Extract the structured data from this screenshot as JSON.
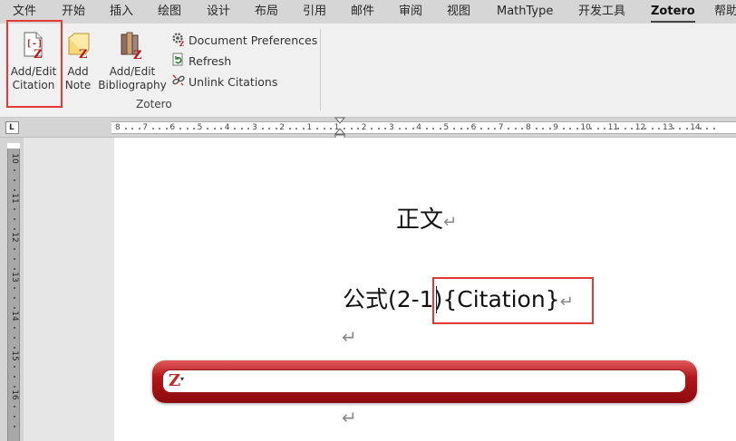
{
  "tabs": [
    {
      "label": "文件",
      "active": false
    },
    {
      "label": "开始",
      "active": false
    },
    {
      "label": "插入",
      "active": false
    },
    {
      "label": "绘图",
      "active": false
    },
    {
      "label": "设计",
      "active": false
    },
    {
      "label": "布局",
      "active": false
    },
    {
      "label": "引用",
      "active": false
    },
    {
      "label": "邮件",
      "active": false
    },
    {
      "label": "审阅",
      "active": false
    },
    {
      "label": "视图",
      "active": false
    },
    {
      "label": "MathType",
      "active": false
    },
    {
      "label": "开发工具",
      "active": false
    },
    {
      "label": "Zotero",
      "active": true
    },
    {
      "label": "帮助",
      "active": false
    }
  ],
  "ribbon": {
    "add_edit_citation": {
      "line1": "Add/Edit",
      "line2": "Citation",
      "icon": "zotero-citation-icon"
    },
    "add_note": {
      "line1": "Add",
      "line2": "Note",
      "icon": "zotero-note-icon"
    },
    "add_edit_bibliography": {
      "line1": "Add/Edit",
      "line2": "Bibliography",
      "icon": "zotero-bibliography-icon"
    },
    "document_preferences": {
      "label": "Document Preferences",
      "icon": "gear-icon"
    },
    "refresh": {
      "label": "Refresh",
      "icon": "refresh-icon"
    },
    "unlink_citations": {
      "label": "Unlink Citations",
      "icon": "unlink-icon"
    },
    "group_label": "Zotero"
  },
  "ruler": {
    "corner_glyph": "L",
    "horizontal_labels": [
      "8",
      "7",
      "6",
      "5",
      "4",
      "3",
      "2",
      "1",
      "1",
      "2",
      "3",
      "4",
      "5",
      "6",
      "7",
      "8",
      "9",
      "10",
      "11",
      "12",
      "13",
      "14"
    ],
    "vertical_labels": [
      "10",
      "11",
      "12",
      "13",
      "14",
      "15",
      "16"
    ]
  },
  "document": {
    "heading": "正文",
    "formula_prefix": "公式(2-1)",
    "citation_field": "{Citation}",
    "paragraph_mark": "↵"
  },
  "zotero_quick_format": {
    "logo": "Z",
    "caret": "▾",
    "value": "",
    "brand_color": "#b3151a"
  },
  "colors": {
    "highlight_box": "#e53935",
    "tabbar_bg": "#d6d6d6",
    "ribbon_bg": "#f0f0f0"
  }
}
